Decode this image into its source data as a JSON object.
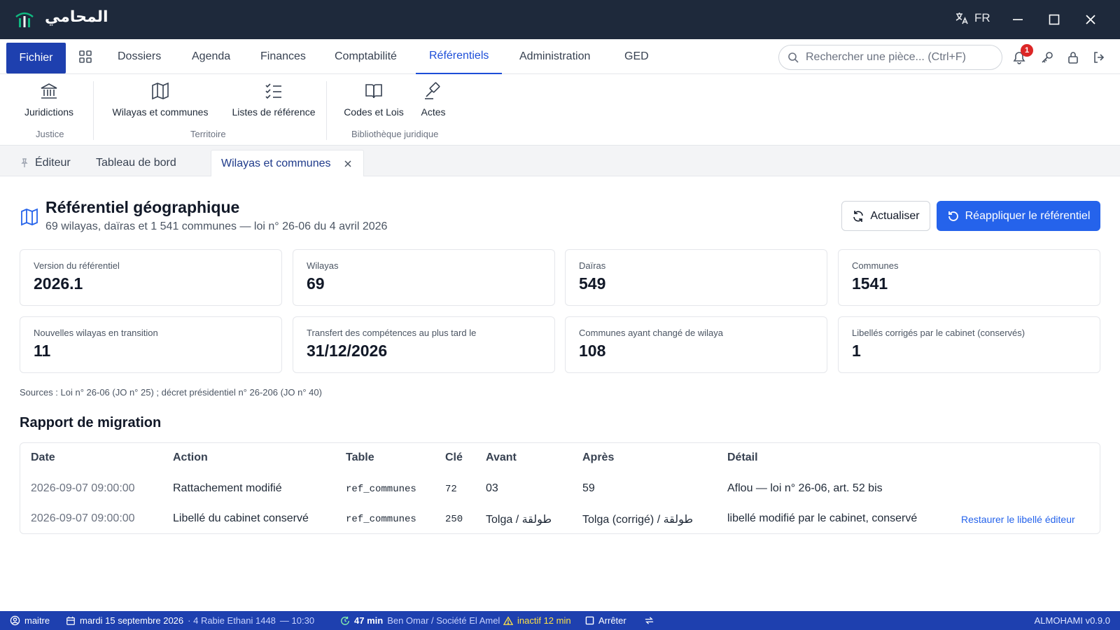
{
  "app": {
    "name": "المحامي",
    "language": "FR"
  },
  "menu": {
    "fichier": "Fichier",
    "items": [
      "Dossiers",
      "Agenda",
      "Finances",
      "Comptabilité",
      "Référentiels",
      "Administration",
      "GED"
    ],
    "active": "Référentiels"
  },
  "search": {
    "placeholder": "Rechercher une pièce... (Ctrl+F)"
  },
  "notifications": {
    "count": "1"
  },
  "ribbon": {
    "buttons": {
      "juridictions": "Juridictions",
      "wilayas": "Wilayas et communes",
      "listes": "Listes de référence",
      "codes": "Codes et Lois",
      "actes": "Actes"
    },
    "groups": {
      "justice": "Justice",
      "territoire": "Territoire",
      "bibliotheque": "Bibliothèque juridique"
    }
  },
  "tabs": {
    "editor": "Éditeur",
    "dashboard": "Tableau de bord",
    "active": "Wilayas et communes"
  },
  "page": {
    "title": "Référentiel géographique",
    "subtitle": "69 wilayas, daïras et 1 541 communes — loi n° 26-06 du 4 avril 2026",
    "refresh_label": "Actualiser",
    "apply_label": "Réappliquer le référentiel"
  },
  "stats": [
    {
      "label": "Version du référentiel",
      "value": "2026.1"
    },
    {
      "label": "Wilayas",
      "value": "69"
    },
    {
      "label": "Daïras",
      "value": "549"
    },
    {
      "label": "Communes",
      "value": "1541"
    },
    {
      "label": "Nouvelles wilayas en transition",
      "value": "11"
    },
    {
      "label": "Transfert des compétences au plus tard le",
      "value": "31/12/2026"
    },
    {
      "label": "Communes ayant changé de wilaya",
      "value": "108"
    },
    {
      "label": "Libellés corrigés par le cabinet (conservés)",
      "value": "1"
    }
  ],
  "sources": "Sources : Loi n° 26-06 (JO n° 25) ; décret présidentiel n° 26-206 (JO n° 40)",
  "migration": {
    "title": "Rapport de migration",
    "columns": {
      "date": "Date",
      "action": "Action",
      "table": "Table",
      "key": "Clé",
      "before": "Avant",
      "after": "Après",
      "detail": "Détail"
    },
    "rows": [
      {
        "date": "2026-09-07 09:00:00",
        "action": "Rattachement modifié",
        "table": "ref_communes",
        "key": "72",
        "before": "03",
        "after": "59",
        "detail": "Aflou — loi n° 26-06, art. 52 bis",
        "link": ""
      },
      {
        "date": "2026-09-07 09:00:00",
        "action": "Libellé du cabinet conservé",
        "table": "ref_communes",
        "key": "250",
        "before": "Tolga / طولقة",
        "after": "Tolga (corrigé) / طولقة",
        "detail": "libellé modifié par le cabinet, conservé",
        "link": "Restaurer le libellé éditeur"
      }
    ]
  },
  "status": {
    "user": "maitre",
    "date": "mardi 15 septembre 2026",
    "hijri": "· 4 Rabie Ethani 1448",
    "time": "— 10:30",
    "timer": "47 min",
    "client": "Ben Omar / Société El Amel",
    "inactive": "inactif 12 min",
    "stop": "Arrêter",
    "version": "ALMOHAMI v0.9.0"
  },
  "colors": {
    "titlebar": "#1e293b",
    "accent": "#2563eb",
    "fichier": "#1e40af",
    "statusbar": "#1e40af",
    "badge": "#dc2626",
    "logo_green": "#10b981"
  }
}
